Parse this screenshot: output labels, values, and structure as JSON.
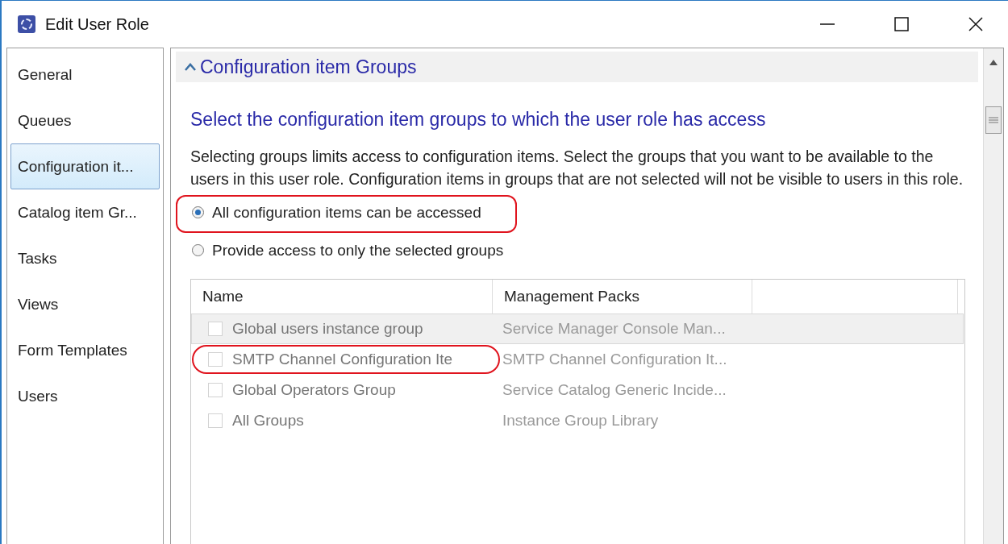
{
  "window": {
    "title": "Edit User Role"
  },
  "sidebar": {
    "items": [
      {
        "label": "General",
        "selected": false
      },
      {
        "label": "Queues",
        "selected": false
      },
      {
        "label": "Configuration it...",
        "selected": true
      },
      {
        "label": "Catalog item Gr...",
        "selected": false
      },
      {
        "label": "Tasks",
        "selected": false
      },
      {
        "label": "Views",
        "selected": false
      },
      {
        "label": "Form Templates",
        "selected": false
      },
      {
        "label": "Users",
        "selected": false
      }
    ]
  },
  "section": {
    "title": "Configuration item Groups",
    "expanded": true,
    "heading": "Select the configuration item groups to which the user role has access",
    "description": "Selecting groups limits access to configuration items. Select the groups that you want to be available to the users in this user role. Configuration items in groups that are not selected will not be visible to users in this role.",
    "options": [
      {
        "label": "All configuration items can be accessed",
        "selected": true,
        "highlighted": true
      },
      {
        "label": "Provide access to only the selected groups",
        "selected": false,
        "highlighted": false
      }
    ],
    "table": {
      "columns": [
        "Name",
        "Management Packs"
      ],
      "disabled": true,
      "rows": [
        {
          "name": "Global users instance group",
          "pack": "Service Manager Console Man...",
          "checked": false,
          "selected": true,
          "highlighted": false
        },
        {
          "name": "SMTP Channel Configuration Ite",
          "pack": "SMTP Channel Configuration It...",
          "checked": false,
          "selected": false,
          "highlighted": true
        },
        {
          "name": "Global Operators Group",
          "pack": "Service Catalog Generic Incide...",
          "checked": false,
          "selected": false,
          "highlighted": false
        },
        {
          "name": "All Groups",
          "pack": "Instance Group Library",
          "checked": false,
          "selected": false,
          "highlighted": false
        }
      ]
    }
  }
}
